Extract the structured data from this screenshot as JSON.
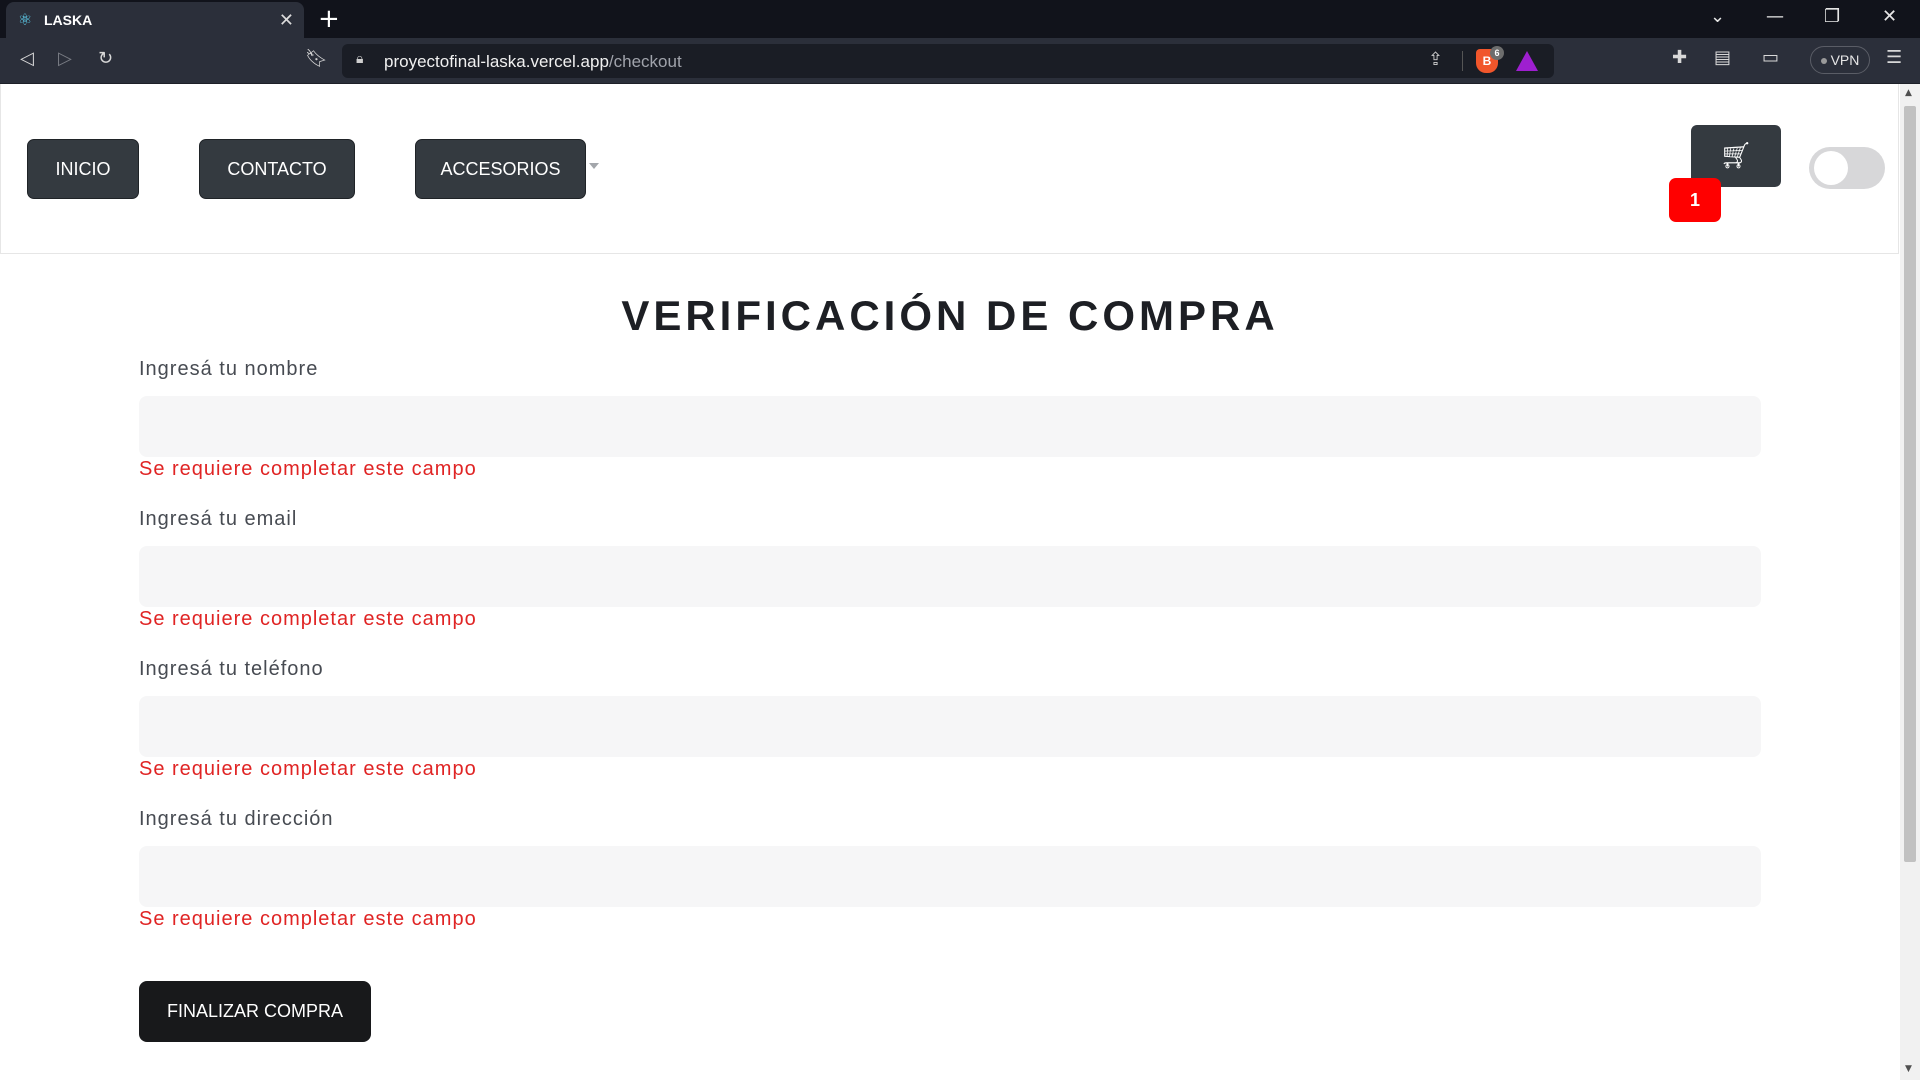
{
  "browser": {
    "tab_title": "LASKA",
    "tab_close": "✕",
    "new_tab": "+",
    "url_host": "proyectofinal-laska.vercel.app",
    "url_path": "/checkout",
    "brave_shield_count": "6",
    "vpn_label": "VPN"
  },
  "nav": {
    "inicio": "INICIO",
    "contacto": "CONTACTO",
    "accesorios": "ACCESORIOS",
    "cart_count": "1"
  },
  "checkout": {
    "title": "VERIFICACIÓN DE COMPRA",
    "fields": [
      {
        "label": "Ingresá tu nombre",
        "value": "",
        "error": "Se requiere completar este campo"
      },
      {
        "label": "Ingresá tu email",
        "value": "",
        "error": "Se requiere completar este campo"
      },
      {
        "label": "Ingresá tu teléfono",
        "value": "",
        "error": "Se requiere completar este campo"
      },
      {
        "label": "Ingresá tu dirección",
        "value": "",
        "error": "Se requiere completar este campo"
      }
    ],
    "submit_label": "FINALIZAR COMPRA"
  },
  "colors": {
    "nav_button_bg": "#343a40",
    "badge_red": "#ff0000",
    "error_text": "#e02424",
    "submit_bg": "#18191b"
  },
  "theme_toggle_on": false
}
